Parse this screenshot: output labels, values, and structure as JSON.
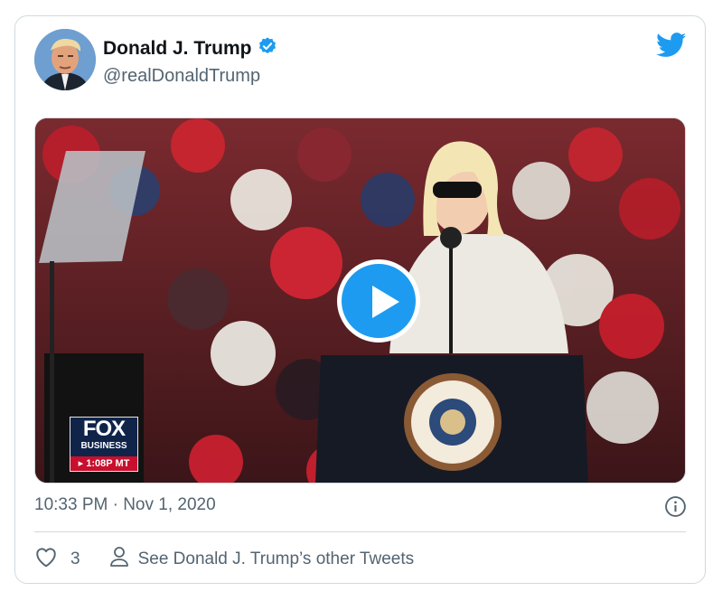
{
  "tweet": {
    "author_name": "Donald J. Trump",
    "handle": "@realDonaldTrump",
    "timestamp": "10:33 PM · Nov 1, 2020",
    "like_count": "3",
    "other_tweets_label": "See Donald J. Trump’s other Tweets"
  },
  "media": {
    "type": "video",
    "overlay": {
      "network": "FOX",
      "network_sub": "BUSINESS",
      "time_label": "▸ 1:08P MT"
    },
    "seal_text": "SEAL OF THE PRESIDENT OF THE UNITED STATES"
  },
  "icons": {
    "verified": "verified-badge-icon",
    "brand": "twitter-bird-icon",
    "play": "play-icon",
    "info": "info-icon",
    "like": "heart-icon",
    "profile": "person-icon"
  },
  "colors": {
    "brand_blue": "#1d9bf0",
    "text_primary": "#0f1419",
    "text_secondary": "#536471",
    "border": "#cfd9de",
    "fox_red": "#c8102e",
    "fox_navy": "#10244a"
  }
}
